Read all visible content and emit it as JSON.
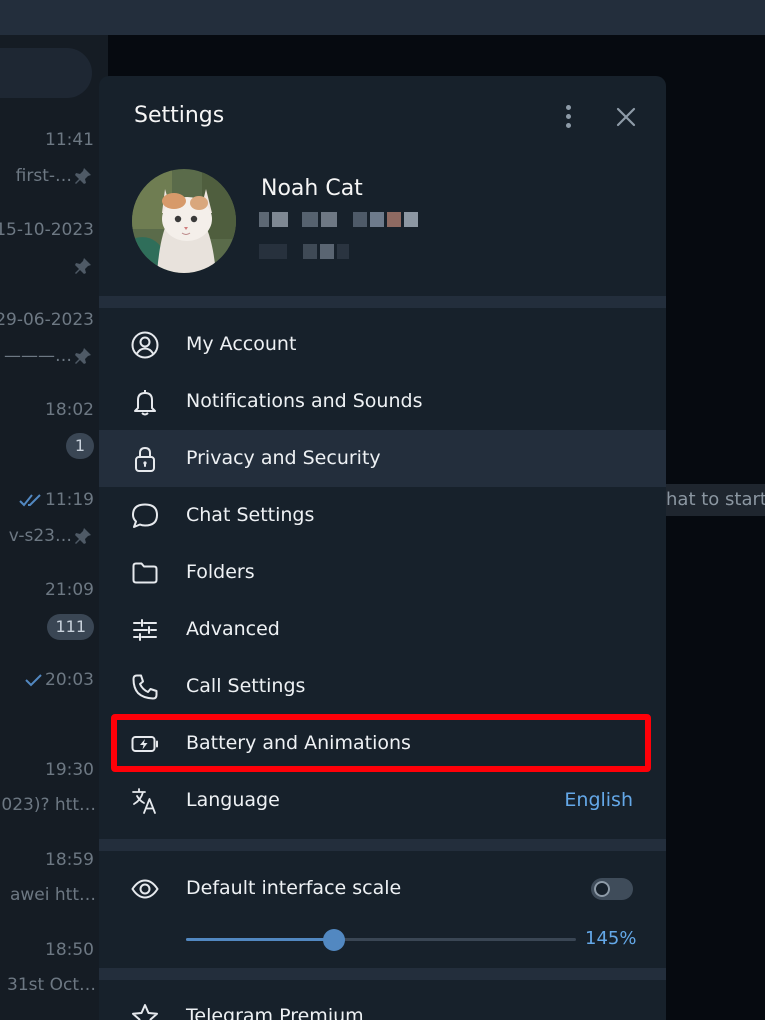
{
  "chatlist": {
    "items": [
      {
        "time": "11:41",
        "preview": "first-…",
        "pinned": true
      },
      {
        "time": "15-10-2023",
        "preview": "",
        "pinned": true
      },
      {
        "time": "29-06-2023",
        "preview": "———…",
        "pinned": true
      },
      {
        "time": "18:02",
        "badge": "1"
      },
      {
        "time": "11:19",
        "preview": "v-s23…",
        "pinned": true,
        "read": "double"
      },
      {
        "time": "21:09",
        "badge": "111"
      },
      {
        "time": "20:03",
        "read": "single"
      },
      {
        "time": "19:30",
        "preview": "023)? htt…"
      },
      {
        "time": "18:59",
        "preview": "awei  htt…"
      },
      {
        "time": "18:50",
        "preview": "31st Oct…"
      }
    ]
  },
  "chatview": {
    "hint": "hat to start"
  },
  "settings": {
    "title": "Settings",
    "profile": {
      "name": "Noah Cat"
    },
    "menu": [
      {
        "label": "My Account",
        "icon": "user-circle-icon"
      },
      {
        "label": "Notifications and Sounds",
        "icon": "bell-icon"
      },
      {
        "label": "Privacy and Security",
        "icon": "lock-icon",
        "active": true
      },
      {
        "label": "Chat Settings",
        "icon": "chat-bubble-icon"
      },
      {
        "label": "Folders",
        "icon": "folder-icon"
      },
      {
        "label": "Advanced",
        "icon": "sliders-icon"
      },
      {
        "label": "Call Settings",
        "icon": "phone-icon"
      },
      {
        "label": "Battery and Animations",
        "icon": "battery-icon",
        "highlighted": true
      },
      {
        "label": "Language",
        "icon": "translate-icon",
        "value": "English"
      }
    ],
    "scale": {
      "label": "Default interface scale",
      "enabled": false,
      "value_label": "145%",
      "value_fraction": 0.38
    },
    "premium": {
      "label": "Telegram Premium"
    }
  },
  "colors": {
    "accent": "#5288c1",
    "link": "#64a8e8",
    "highlight_border": "#ff0008",
    "panel": "#17212b"
  }
}
